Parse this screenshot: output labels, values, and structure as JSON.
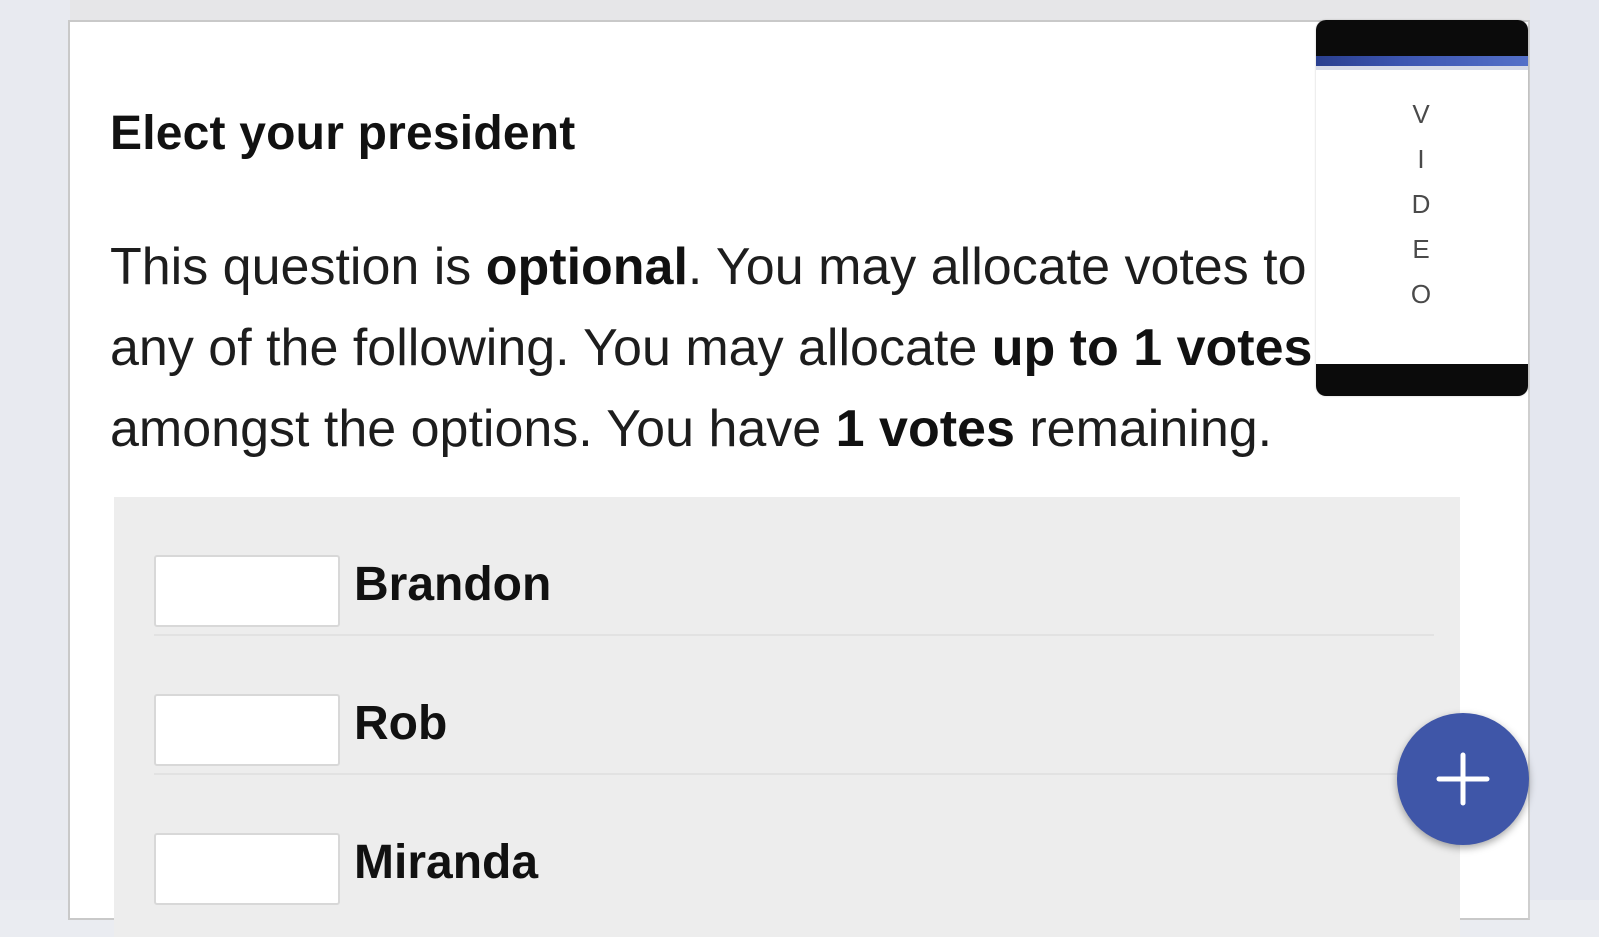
{
  "question": {
    "title": "Elect your president",
    "instructions": {
      "part1": "This question is ",
      "optional": "optional",
      "part2": ". You may allocate votes to any of the following. You may allocate ",
      "max_votes": "up to 1 votes",
      "part3": " amongst the options. You have ",
      "remaining": "1 votes",
      "part4": " remaining."
    },
    "options": [
      {
        "label": "Brandon",
        "value": ""
      },
      {
        "label": "Rob",
        "value": ""
      },
      {
        "label": "Miranda",
        "value": ""
      }
    ]
  },
  "video_overlay": {
    "letters": [
      "V",
      "I",
      "D",
      "E",
      "O"
    ]
  },
  "fab": {
    "icon": "plus-icon"
  },
  "colors": {
    "fab": "#3f56a8",
    "options_background": "#ededed",
    "page_background": "#eaecf1"
  }
}
